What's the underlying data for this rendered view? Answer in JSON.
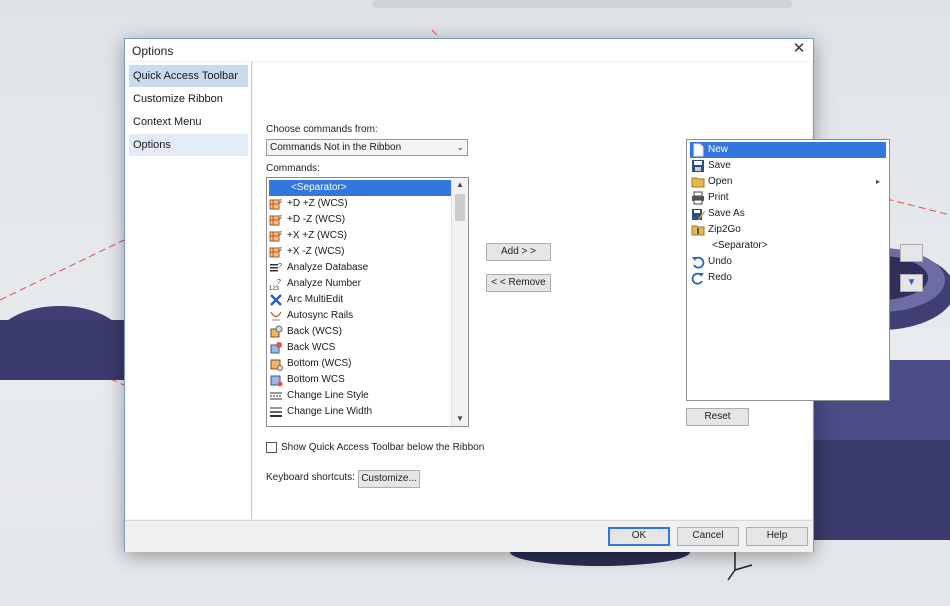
{
  "window": {
    "title": "Options"
  },
  "sidebar": {
    "items": [
      {
        "label": "Quick Access Toolbar"
      },
      {
        "label": "Customize Ribbon"
      },
      {
        "label": "Context Menu"
      },
      {
        "label": "Options"
      }
    ]
  },
  "choose": {
    "label": "Choose commands from:",
    "selected": "Commands Not in the Ribbon"
  },
  "commands": {
    "label": "Commands:",
    "items": [
      {
        "label": "<Separator>",
        "icon": "none"
      },
      {
        "label": "+D +Z (WCS)",
        "icon": "view-cube-icon"
      },
      {
        "label": "+D -Z (WCS)",
        "icon": "view-cube-icon"
      },
      {
        "label": "+X +Z (WCS)",
        "icon": "view-cube-icon"
      },
      {
        "label": "+X -Z (WCS)",
        "icon": "view-cube-icon"
      },
      {
        "label": "Analyze Database",
        "icon": "analyze-icon"
      },
      {
        "label": "Analyze Number",
        "icon": "analyze-number-icon"
      },
      {
        "label": "Arc MultiEdit",
        "icon": "arc-edit-icon"
      },
      {
        "label": "Autosync Rails",
        "icon": "autosync-icon"
      },
      {
        "label": "Back (WCS)",
        "icon": "view-back-icon"
      },
      {
        "label": "Back WCS",
        "icon": "view-back-icon"
      },
      {
        "label": "Bottom (WCS)",
        "icon": "view-bottom-icon"
      },
      {
        "label": "Bottom WCS",
        "icon": "view-bottom-icon"
      },
      {
        "label": "Change Line Style",
        "icon": "line-style-icon"
      },
      {
        "label": "Change Line Width",
        "icon": "line-width-icon"
      }
    ]
  },
  "buttons": {
    "add": "Add > >",
    "remove": "< < Remove",
    "reset": "Reset",
    "customize": "Customize...",
    "ok": "OK",
    "cancel": "Cancel",
    "help": "Help"
  },
  "qat": {
    "items": [
      {
        "label": "New",
        "icon": "new-file-icon"
      },
      {
        "label": "Save",
        "icon": "save-icon"
      },
      {
        "label": "Open",
        "icon": "open-folder-icon",
        "submenu": "▸"
      },
      {
        "label": "Print",
        "icon": "print-icon"
      },
      {
        "label": "Save As",
        "icon": "save-as-icon"
      },
      {
        "label": "Zip2Go",
        "icon": "zip-icon"
      },
      {
        "label": "<Separator>",
        "icon": "none"
      },
      {
        "label": "Undo",
        "icon": "undo-icon"
      },
      {
        "label": "Redo",
        "icon": "redo-icon"
      }
    ]
  },
  "show_below": {
    "label": "Show Quick Access Toolbar below the Ribbon",
    "checked": false
  },
  "shortcuts": {
    "label": "Keyboard shortcuts:"
  },
  "colors": {
    "accent": "#3277e0",
    "selection_light": "#c9daf0"
  }
}
